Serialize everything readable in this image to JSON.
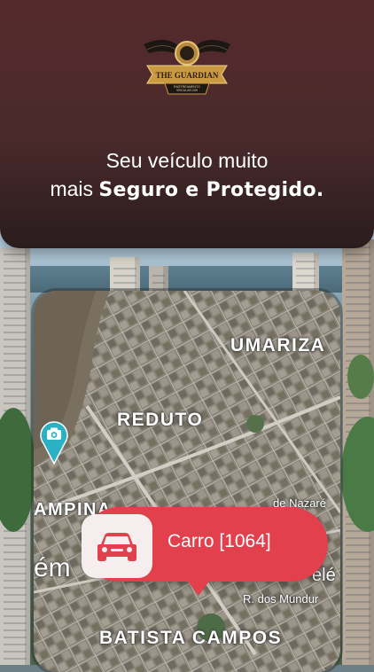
{
  "header": {
    "logo_alt": "THE GUARDIAN RASTREAMENTO VEICULAR 24H",
    "tagline_line1": "Seu veículo muito",
    "tagline_line2_prefix": "mais ",
    "tagline_line2_bold": "Seguro e Protegido."
  },
  "map": {
    "labels": {
      "umarizal": "UMARIZA",
      "reduto": "REDUTO",
      "campina": "AMPINA",
      "nazare": "de Nazaré",
      "belem": "ém",
      "bele": "elé",
      "mundurucus": "R. dos Mundur",
      "batista_campos": "BATISTA CAMPOS"
    }
  },
  "vehicle": {
    "label": "Carro [1064]",
    "color": "#e2404d"
  }
}
